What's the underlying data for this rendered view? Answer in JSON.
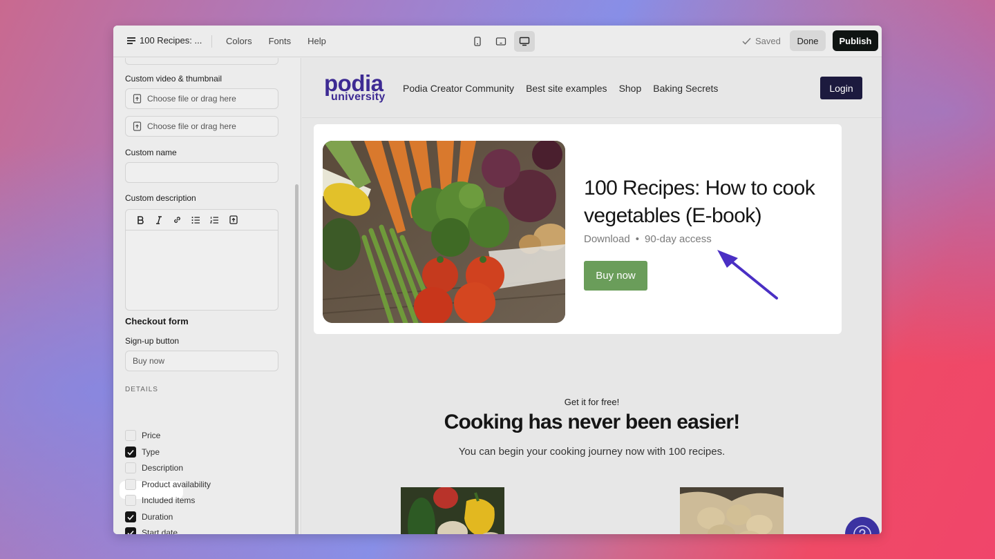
{
  "toolbar": {
    "doc_title": "100 Recipes: ...",
    "menu_items": [
      "Colors",
      "Fonts",
      "Help"
    ],
    "saved_label": "Saved",
    "done_label": "Done",
    "publish_label": "Publish",
    "devices": [
      "mobile-device-icon",
      "tablet-device-icon",
      "desktop-device-icon"
    ],
    "active_device": "desktop"
  },
  "sidebar": {
    "custom_video_label": "Custom video & thumbnail",
    "upload_video_placeholder": "Choose file or drag here",
    "upload_thumbnail_placeholder": "Choose file or drag here",
    "custom_name_label": "Custom name",
    "custom_name_value": "",
    "custom_description_label": "Custom description",
    "editor_tools": [
      "bold-icon",
      "italic-icon",
      "link-icon",
      "bullet-list-icon",
      "numbered-list-icon",
      "upload-icon"
    ],
    "checkout_form_label": "Checkout form",
    "signup_button_label": "Sign-up button",
    "signup_button_value": "Buy now",
    "details_label": "DETAILS",
    "details": [
      {
        "label": "Price",
        "checked": false
      },
      {
        "label": "Type",
        "checked": true
      },
      {
        "label": "Description",
        "checked": false
      },
      {
        "label": "Product availability",
        "checked": false
      },
      {
        "label": "Included items",
        "checked": false
      },
      {
        "label": "Duration",
        "checked": true
      },
      {
        "label": "Start date",
        "checked": true
      }
    ]
  },
  "site": {
    "logo_line1": "podia",
    "logo_line2": "university",
    "nav": [
      "Podia Creator Community",
      "Best site examples",
      "Shop",
      "Baking Secrets"
    ],
    "login_label": "Login",
    "product": {
      "title": "100 Recipes: How to cook vegetables (E-book)",
      "meta_type": "Download",
      "meta_separator": "•",
      "meta_duration": "90-day access",
      "buy_label": "Buy now"
    },
    "free_label": "Get it for free!",
    "headline": "Cooking has never been easier!",
    "subline": "You can begin your cooking journey now with 100 recipes."
  },
  "colors": {
    "brand": "#3d2a93",
    "buy_button": "#6a9d5a",
    "login_button": "#1c1a3e",
    "publish_button": "#0f1412",
    "arrow": "#4a2fc4",
    "help_button": "#3b32a1"
  }
}
